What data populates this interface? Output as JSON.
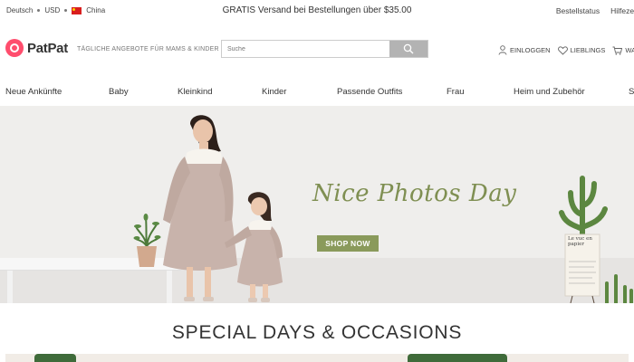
{
  "topbar": {
    "language": "Deutsch",
    "currency": "USD",
    "country": "China",
    "promo": "GRATIS Versand bei Bestellungen über $35.00",
    "order_status": "Bestellstatus",
    "help": "Hilfezentr"
  },
  "header": {
    "logo_text": "PatPat",
    "tagline": "TÄGLICHE ANGEBOTE FÜR MAMS & KINDER",
    "search_placeholder": "Suche",
    "login": "EINLOGGEN",
    "favorites": "LIEBLINGS",
    "cart": "WAG"
  },
  "nav": {
    "items": [
      "Neue Ankünfte",
      "Baby",
      "Kleinkind",
      "Kinder",
      "Passende Outfits",
      "Frau",
      "Heim und Zubehör",
      "S"
    ]
  },
  "hero": {
    "title": "Nice Photos Day",
    "cta": "SHOP NOW",
    "accent_color": "#8a9a5b",
    "sign_text": "Le vuc en papier"
  },
  "section": {
    "title": "SPECIAL DAYS & OCCASIONS"
  },
  "colors": {
    "brand": "#ff4d6d",
    "hero_bg": "#efeeec"
  }
}
